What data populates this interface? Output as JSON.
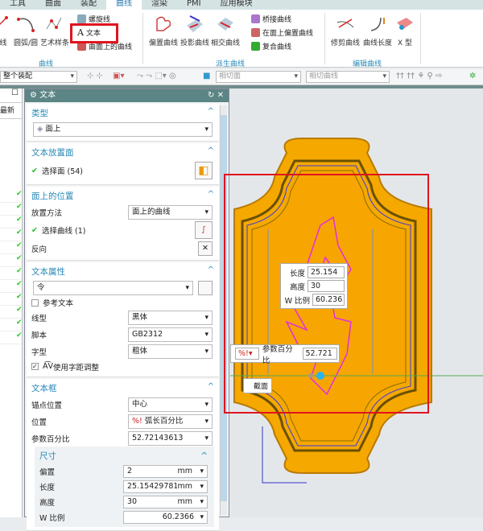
{
  "tabs": [
    "工具",
    "曲面",
    "装配",
    "曲线",
    "渲染",
    "PMI",
    "应用模块"
  ],
  "ribbon": {
    "curve_group": {
      "label": "曲线",
      "items": [
        "线",
        "圆弧/圆",
        "艺术样条"
      ],
      "small": [
        "螺旋线",
        "文本",
        "曲面上的曲线"
      ]
    },
    "derived_group": {
      "label": "派生曲线",
      "items": [
        "偏置曲线",
        "投影曲线",
        "相交曲线"
      ],
      "small": [
        "桥接曲线",
        "在面上偏置曲线",
        "复合曲线"
      ]
    },
    "edit_group": {
      "label": "编辑曲线",
      "items": [
        "修剪曲线",
        "曲线长度",
        "X 型"
      ]
    }
  },
  "toolbar": {
    "scope": "整个装配",
    "filter1": "相切面",
    "filter2": "相切曲线"
  },
  "navigator": {
    "header": "最新"
  },
  "dialog": {
    "title": "文本",
    "type": {
      "title": "类型",
      "value": "面上"
    },
    "face": {
      "title": "文本放置面",
      "select": "选择面 (54)"
    },
    "position": {
      "title": "面上的位置",
      "method_label": "放置方法",
      "method": "面上的曲线",
      "select_curve": "选择曲线 (1)",
      "reverse": "反向"
    },
    "props": {
      "title": "文本属性",
      "text": "令",
      "ref_text": "参考文本",
      "line_label": "线型",
      "line": "黑体",
      "script_label": "脚本",
      "script": "GB2312",
      "style_label": "字型",
      "style": "粗体",
      "kerning": "使用字距调整"
    },
    "frame": {
      "title": "文本框",
      "anchor_label": "锚点位置",
      "anchor": "中心",
      "pos_label": "位置",
      "pos": "弧长百分比",
      "param_label": "参数百分比",
      "param": "52.72143613",
      "size": {
        "title": "尺寸",
        "offset_label": "偏置",
        "offset": "2",
        "length_label": "长度",
        "length": "25.15429781",
        "height_label": "高度",
        "height": "30",
        "unit": "mm",
        "wscale_label": "W 比例",
        "wscale": "60.2366"
      }
    }
  },
  "viewport": {
    "length_label": "长度",
    "length": "25.154",
    "height_label": "高度",
    "height": "30",
    "wscale_label": "W 比例",
    "wscale": "60.236",
    "param_label": "参数百分比",
    "param": "52.721",
    "section": "截面"
  }
}
